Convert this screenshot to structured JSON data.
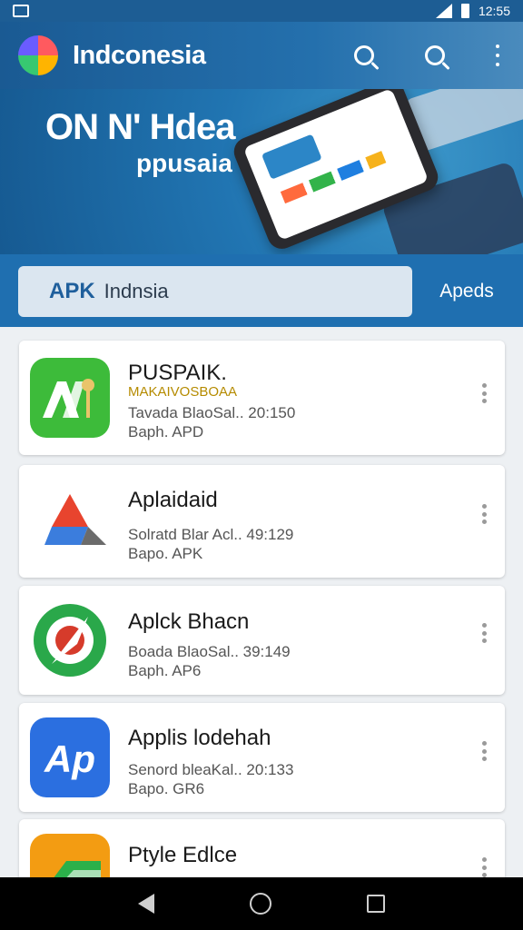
{
  "status_bar": {
    "time": "12:55"
  },
  "app_bar": {
    "title": "Indconesia"
  },
  "hero": {
    "title": "ON N' Hdea",
    "subtitle": "ppusaia"
  },
  "search": {
    "prefix": "APK",
    "query": "Indnsia",
    "button_label": "Apeds"
  },
  "apps": [
    {
      "name": "PUSPAIK.",
      "tagline": "MAKAIVOSBOAA",
      "meta1": "Tavada BlaoSal.. 20:150",
      "meta2": "Baph. APD",
      "icon": "apk-pen-icon",
      "color": "#3dbb3a"
    },
    {
      "name": "Aplaidaid",
      "tagline": "",
      "meta1": "Solratd Blar Acl.. 49:129",
      "meta2": "Bapo. APK",
      "icon": "triangle-logo-icon",
      "color": "#ffffff"
    },
    {
      "name": "Aplck Bhacn",
      "tagline": "",
      "meta1": "Boada BlaoSal.. 39:149",
      "meta2": "Baph. AP6",
      "icon": "compass-icon",
      "color": "#2aa84a"
    },
    {
      "name": "Applis lodehah",
      "tagline": "",
      "meta1": "Senord bleaKal.. 20:133",
      "meta2": "Bapo. GR6",
      "icon": "ap-letters-icon",
      "color": "#2b6fe0"
    },
    {
      "name": "Ptyle Edlce",
      "tagline": "",
      "meta1": "",
      "meta2": "",
      "icon": "folder-green-icon",
      "color": "#f39c12"
    }
  ]
}
